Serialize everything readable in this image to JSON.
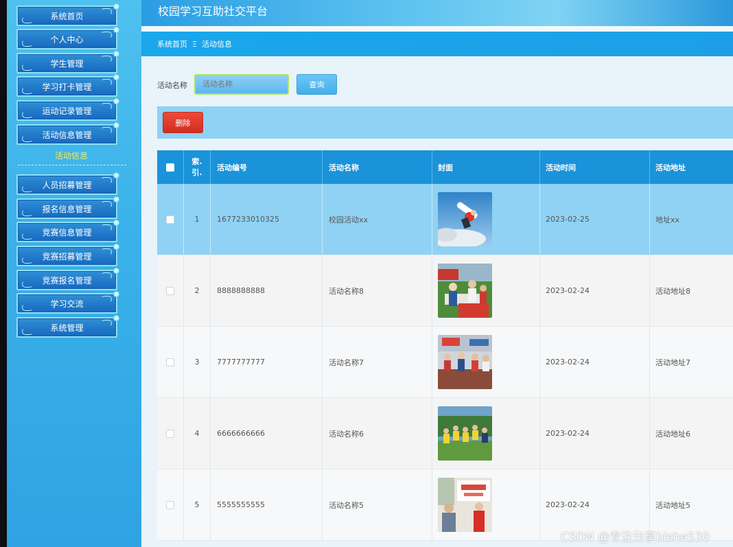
{
  "app": {
    "title": "校园学习互助社交平台"
  },
  "sidebar": {
    "items": [
      {
        "label": "系统首页"
      },
      {
        "label": "个人中心"
      },
      {
        "label": "学生管理"
      },
      {
        "label": "学习打卡管理"
      },
      {
        "label": "运动记录管理"
      },
      {
        "label": "活动信息管理"
      },
      {
        "label": "人员招募管理"
      },
      {
        "label": "报名信息管理"
      },
      {
        "label": "竞赛信息管理"
      },
      {
        "label": "竞赛招募管理"
      },
      {
        "label": "竞赛报名管理"
      },
      {
        "label": "学习交流"
      },
      {
        "label": "系统管理"
      }
    ],
    "submenu_active": "活动信息"
  },
  "breadcrumb": {
    "home": "系统首页",
    "separator": "Ξ",
    "current": "活动信息"
  },
  "search": {
    "label": "活动名称",
    "placeholder": "活动名称",
    "value": "",
    "button": "查询"
  },
  "toolbar": {
    "delete_label": "删除"
  },
  "table": {
    "columns": [
      "索引",
      "活动编号",
      "活动名称",
      "封面",
      "活动时间",
      "活动地址"
    ],
    "index_header_line1": "索.",
    "index_header_line2": "引.",
    "rows": [
      {
        "index": "1",
        "code": "1677233010325",
        "name": "校园活动xx",
        "cover": "snowboard-photo",
        "time": "2023-02-25",
        "address": "地址xx",
        "selected": true
      },
      {
        "index": "2",
        "code": "8888888888",
        "name": "活动名称8",
        "cover": "event-photo-8",
        "time": "2023-02-24",
        "address": "活动地址8",
        "selected": false
      },
      {
        "index": "3",
        "code": "7777777777",
        "name": "活动名称7",
        "cover": "event-photo-7",
        "time": "2023-02-24",
        "address": "活动地址7",
        "selected": false
      },
      {
        "index": "4",
        "code": "6666666666",
        "name": "活动名称6",
        "cover": "event-photo-6",
        "time": "2023-02-24",
        "address": "活动地址6",
        "selected": false
      },
      {
        "index": "5",
        "code": "5555555555",
        "name": "活动名称5",
        "cover": "event-photo-5",
        "time": "2023-02-24",
        "address": "活动地址5",
        "selected": false
      }
    ]
  },
  "watermark": "CSDN @专注分享bishe530",
  "colors": {
    "accent": "#1a93da",
    "danger": "#d22e20",
    "sidebar": "#3bb2ea",
    "selected_row": "#8fd2f4"
  }
}
